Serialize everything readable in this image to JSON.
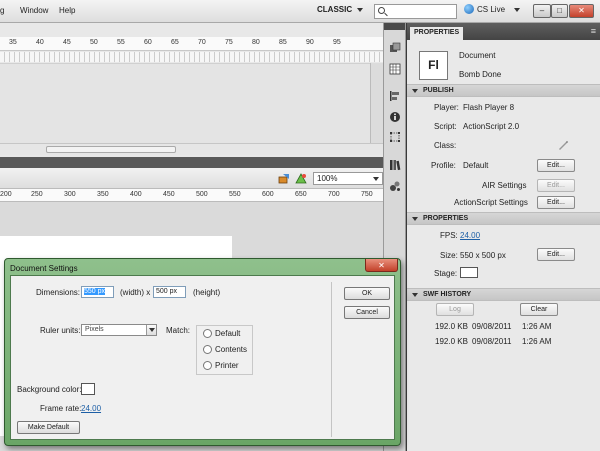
{
  "menubar": {
    "items": [
      "g",
      "Window",
      "Help"
    ],
    "workspace": "CLASSIC",
    "cs_live": "CS Live",
    "window_controls": [
      "–",
      "□",
      "✕"
    ]
  },
  "timeline": {
    "ruler_ticks": [
      "35",
      "40",
      "45",
      "50",
      "55",
      "60",
      "65",
      "70",
      "75",
      "80",
      "85",
      "90",
      "95"
    ]
  },
  "stage": {
    "zoom": "100%",
    "ruler_ticks": [
      "200",
      "250",
      "300",
      "350",
      "400",
      "450",
      "500",
      "550",
      "600",
      "650",
      "700",
      "750"
    ]
  },
  "properties": {
    "tab": "PROPERTIES",
    "doc_icon": "Fl",
    "doc_type": "Document",
    "doc_name": "Bomb Done",
    "publish": {
      "header": "PUBLISH",
      "player_label": "Player:",
      "player_value": "Flash Player 8",
      "script_label": "Script:",
      "script_value": "ActionScript 2.0",
      "class_label": "Class:",
      "profile_label": "Profile:",
      "profile_value": "Default",
      "edit_label": "Edit...",
      "air_settings": "AIR Settings",
      "actionscript_settings": "ActionScript Settings"
    },
    "props_section": {
      "header": "PROPERTIES",
      "fps_label": "FPS:",
      "fps_value": "24.00",
      "size_label": "Size:",
      "size_value": "550 x 500 px",
      "stage_label": "Stage:",
      "stage_color": "#ffffff"
    },
    "swf_history": {
      "header": "SWF HISTORY",
      "log_button": "Log",
      "clear_button": "Clear",
      "entries": [
        {
          "size": "192.0 KB",
          "date": "09/08/2011",
          "time": "1:26 AM"
        },
        {
          "size": "192.0 KB",
          "date": "09/08/2011",
          "time": "1:26 AM"
        }
      ]
    }
  },
  "dialog": {
    "title": "Document Settings",
    "close": "✕",
    "dimensions_label": "Dimensions:",
    "width_value": "550 px",
    "width_suffix": "(width) x",
    "height_value": "500 px",
    "height_suffix": "(height)",
    "ruler_units_label": "Ruler units:",
    "ruler_units_value": "Pixels",
    "match_label": "Match:",
    "match_options": [
      "Default",
      "Contents",
      "Printer"
    ],
    "background_color_label": "Background color:",
    "background_color": "#ffffff",
    "frame_rate_label": "Frame rate:",
    "frame_rate_value": "24.00",
    "make_default": "Make Default",
    "ok": "OK",
    "cancel": "Cancel"
  },
  "colors": {
    "dialog_frame": "#7ab376",
    "link": "#1d5fa6",
    "selection": "#3399ff"
  }
}
